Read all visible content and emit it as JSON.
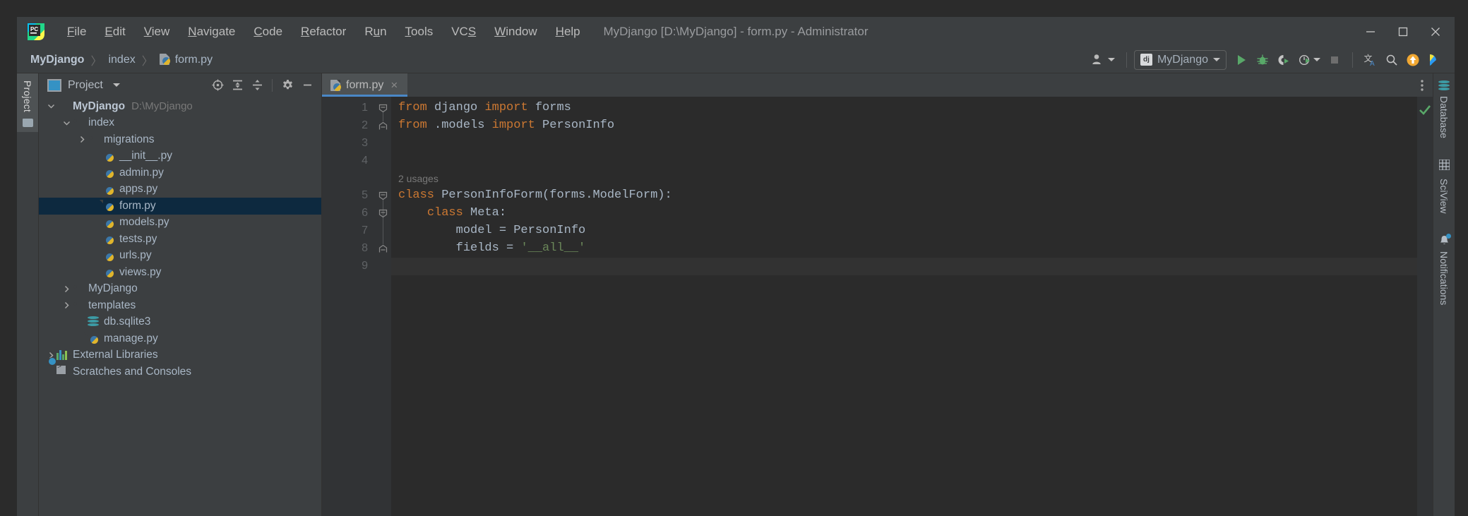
{
  "window": {
    "title": "MyDjango [D:\\MyDjango] - form.py - Administrator",
    "minimize_label": "─",
    "maximize_label": "☐",
    "close_label": "✕",
    "logo_text": "PC"
  },
  "menubar": {
    "items": [
      {
        "name": "file",
        "pre": "",
        "mnemonic": "F",
        "post": "ile"
      },
      {
        "name": "edit",
        "pre": "",
        "mnemonic": "E",
        "post": "dit"
      },
      {
        "name": "view",
        "pre": "",
        "mnemonic": "V",
        "post": "iew"
      },
      {
        "name": "navigate",
        "pre": "",
        "mnemonic": "N",
        "post": "avigate"
      },
      {
        "name": "code",
        "pre": "",
        "mnemonic": "C",
        "post": "ode"
      },
      {
        "name": "refactor",
        "pre": "",
        "mnemonic": "R",
        "post": "efactor"
      },
      {
        "name": "run",
        "pre": "R",
        "mnemonic": "u",
        "post": "n"
      },
      {
        "name": "tools",
        "pre": "",
        "mnemonic": "T",
        "post": "ools"
      },
      {
        "name": "vcs",
        "pre": "VC",
        "mnemonic": "S",
        "post": ""
      },
      {
        "name": "window",
        "pre": "",
        "mnemonic": "W",
        "post": "indow"
      },
      {
        "name": "help",
        "pre": "",
        "mnemonic": "H",
        "post": "elp"
      }
    ]
  },
  "breadcrumb": {
    "items": [
      "MyDjango",
      "index",
      "form.py"
    ],
    "separator": "〉"
  },
  "toolbar": {
    "account_icon": "user-icon",
    "run_config": "MyDjango",
    "run_config_icon": "dj",
    "buttons": [
      {
        "name": "run-button",
        "icon": "play-icon",
        "color": "#59a869"
      },
      {
        "name": "debug-button",
        "icon": "bug-icon",
        "color": "#59a869"
      },
      {
        "name": "run-coverage-button",
        "icon": "coverage-icon",
        "color": "#59a869"
      },
      {
        "name": "profile-button",
        "icon": "profile-icon",
        "color": "#59a869"
      },
      {
        "name": "stop-button",
        "icon": "stop-icon",
        "color": "#6e6e6e"
      }
    ],
    "translate_icon": "translate-icon",
    "search_icon": "search-icon",
    "update_icon": "update-arrow-icon",
    "ide_icon": "ide-feature-icon"
  },
  "project_panel": {
    "title": "Project",
    "header_icons": [
      "locate-icon",
      "expand-all-icon",
      "collapse-all-icon",
      "gear-icon",
      "hide-icon"
    ],
    "tree": [
      {
        "label": "MyDjango",
        "path": "D:\\MyDjango",
        "icon": "folder",
        "indent": 0,
        "arrow": "down",
        "bold": true,
        "selected": false
      },
      {
        "label": "index",
        "icon": "folder-src",
        "indent": 1,
        "arrow": "down",
        "bold": false,
        "selected": false
      },
      {
        "label": "migrations",
        "icon": "folder-src",
        "indent": 2,
        "arrow": "right",
        "bold": false,
        "selected": false
      },
      {
        "label": "__init__.py",
        "icon": "py",
        "indent": 3,
        "arrow": "none",
        "bold": false,
        "selected": false
      },
      {
        "label": "admin.py",
        "icon": "py",
        "indent": 3,
        "arrow": "none",
        "bold": false,
        "selected": false
      },
      {
        "label": "apps.py",
        "icon": "py",
        "indent": 3,
        "arrow": "none",
        "bold": false,
        "selected": false
      },
      {
        "label": "form.py",
        "icon": "py",
        "indent": 3,
        "arrow": "none",
        "bold": false,
        "selected": true
      },
      {
        "label": "models.py",
        "icon": "py",
        "indent": 3,
        "arrow": "none",
        "bold": false,
        "selected": false
      },
      {
        "label": "tests.py",
        "icon": "py",
        "indent": 3,
        "arrow": "none",
        "bold": false,
        "selected": false
      },
      {
        "label": "urls.py",
        "icon": "py",
        "indent": 3,
        "arrow": "none",
        "bold": false,
        "selected": false
      },
      {
        "label": "views.py",
        "icon": "py",
        "indent": 3,
        "arrow": "none",
        "bold": false,
        "selected": false
      },
      {
        "label": "MyDjango",
        "icon": "folder-src",
        "indent": 1,
        "arrow": "right",
        "bold": false,
        "selected": false
      },
      {
        "label": "templates",
        "icon": "folder-tpl",
        "indent": 1,
        "arrow": "right",
        "bold": false,
        "selected": false
      },
      {
        "label": "db.sqlite3",
        "icon": "db",
        "indent": 2,
        "arrow": "none",
        "bold": false,
        "selected": false
      },
      {
        "label": "manage.py",
        "icon": "py",
        "indent": 2,
        "arrow": "none",
        "bold": false,
        "selected": false
      },
      {
        "label": "External Libraries",
        "icon": "libs",
        "indent": 0,
        "arrow": "right",
        "bold": false,
        "selected": false
      },
      {
        "label": "Scratches and Consoles",
        "icon": "scratch",
        "indent": 0,
        "arrow": "none",
        "bold": false,
        "selected": false
      }
    ]
  },
  "left_stripe": {
    "tab_label": "Project"
  },
  "right_stripe": {
    "tabs": [
      {
        "label": "Database",
        "icon": "database-icon"
      },
      {
        "label": "SciView",
        "icon": "grid-icon"
      },
      {
        "label": "Notifications",
        "icon": "bell-icon",
        "badge": true
      }
    ]
  },
  "editor": {
    "tab": {
      "label": "form.py",
      "icon": "py-file-icon",
      "close": "×"
    },
    "inspection_status": "✓",
    "current_line": 9,
    "code_hint": {
      "line": 5,
      "text": "2 usages"
    },
    "lines": [
      {
        "n": 1,
        "tokens": [
          {
            "t": "from",
            "c": "kw"
          },
          {
            "t": " django ",
            "c": ""
          },
          {
            "t": "import",
            "c": "kw"
          },
          {
            "t": " forms",
            "c": ""
          }
        ]
      },
      {
        "n": 2,
        "tokens": [
          {
            "t": "from",
            "c": "kw"
          },
          {
            "t": " .models ",
            "c": ""
          },
          {
            "t": "import",
            "c": "kw"
          },
          {
            "t": " PersonInfo",
            "c": ""
          }
        ]
      },
      {
        "n": 3,
        "tokens": []
      },
      {
        "n": 4,
        "tokens": []
      },
      {
        "n": 5,
        "tokens": [
          {
            "t": "class",
            "c": "kw"
          },
          {
            "t": " PersonInfoForm(forms.ModelForm):",
            "c": ""
          }
        ]
      },
      {
        "n": 6,
        "tokens": [
          {
            "t": "    ",
            "c": ""
          },
          {
            "t": "class",
            "c": "kw"
          },
          {
            "t": " Meta:",
            "c": ""
          }
        ]
      },
      {
        "n": 7,
        "tokens": [
          {
            "t": "        model = PersonInfo",
            "c": ""
          }
        ]
      },
      {
        "n": 8,
        "tokens": [
          {
            "t": "        fields = ",
            "c": ""
          },
          {
            "t": "'__all__'",
            "c": "str"
          }
        ]
      },
      {
        "n": 9,
        "tokens": []
      }
    ]
  },
  "colors": {
    "keyword": "#cc7832",
    "string": "#6a8759",
    "text": "#a9b7c6",
    "selection": "#0d293f",
    "accent": "#4a88c7",
    "run_green": "#59a869"
  }
}
